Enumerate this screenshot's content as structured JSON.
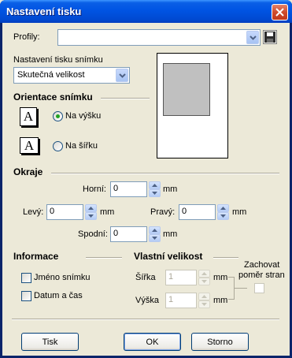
{
  "window": {
    "title": "Nastavení tisku"
  },
  "profiles": {
    "label": "Profily:",
    "value": ""
  },
  "print_settings": {
    "label": "Nastavení tisku snímku",
    "selected": "Skutečná velikost"
  },
  "orientation": {
    "title": "Orientace snímku",
    "icon_letter": "A",
    "portrait_label": "Na výšku",
    "landscape_label": "Na šířku",
    "selected": "portrait"
  },
  "margins": {
    "title": "Okraje",
    "top_label": "Horní:",
    "top_value": "0",
    "left_label": "Levý:",
    "left_value": "0",
    "right_label": "Pravý:",
    "right_value": "0",
    "bottom_label": "Spodní:",
    "bottom_value": "0",
    "unit": "mm"
  },
  "info": {
    "title": "Informace",
    "image_name_label": "Jméno snímku",
    "date_time_label": "Datum a čas"
  },
  "custom_size": {
    "title": "Vlastní velikost",
    "width_label": "Šířka",
    "width_value": "1",
    "height_label": "Výška",
    "height_value": "1",
    "unit": "mm",
    "keep_ratio_label_line1": "Zachovat",
    "keep_ratio_label_line2": "poměr stran"
  },
  "buttons": {
    "print": "Tisk",
    "ok": "OK",
    "cancel": "Storno"
  },
  "colors": {
    "titlebar": "#0054e3",
    "close": "#cf4b2c",
    "face": "#ece9d8",
    "radio_dot": "#21a121"
  }
}
